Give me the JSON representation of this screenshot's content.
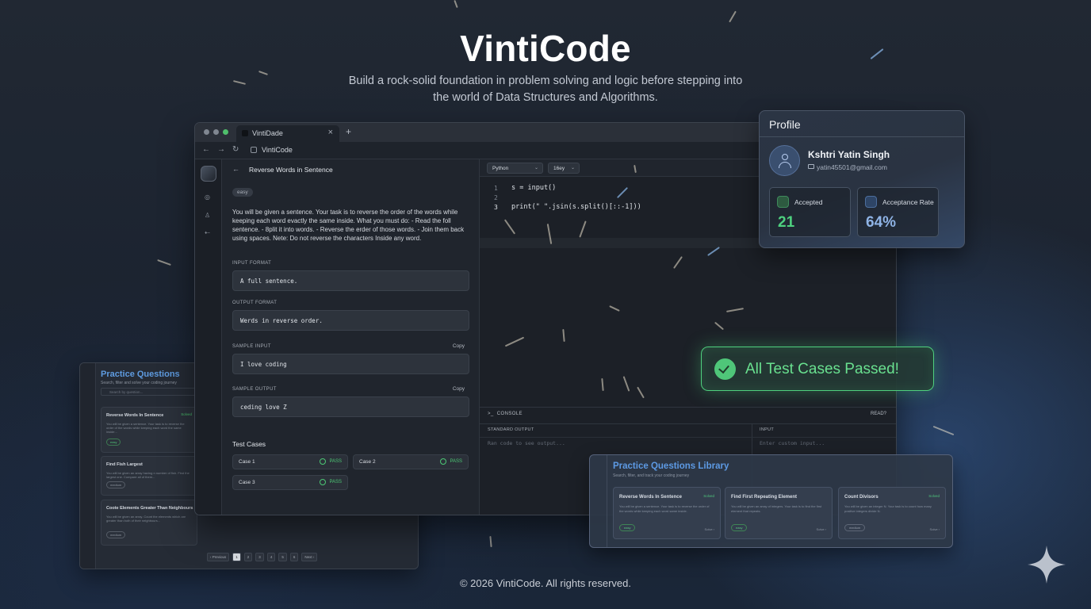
{
  "hero": {
    "title": "VintiCode",
    "subtitle": "Build a rock-solid foundation in problem solving and logic before stepping into the world of Data Structures and Algorithms."
  },
  "footer": "© 2026 VintiCode. All rights reserved.",
  "browser": {
    "tab_title": "VintiDade",
    "tab_close": "×",
    "new_tab": "+",
    "url": "VintiCode",
    "nav_back": "←",
    "nav_forward": "→",
    "nav_reload": "↻"
  },
  "problem": {
    "back": "←",
    "title": "Reverse Words in Sentence",
    "difficulty": "easy",
    "description": "You will be given a sentence. Your task is to reverse the order of the words while keeping each word evactly the same inside. What you must do: - Read the foll sentence. - 8plit it into words. - Reverse the erder of those words. - Join them back using spaces. Nete: Do not reverse the characters Inside any word.",
    "input_format_label": "INPUT FORMAT",
    "input_format": "A full sentence.",
    "output_format_label": "OUTPUT FORMAT",
    "output_format": "Werds in reverse order.",
    "sample_input_label": "SAMPLE INPUT",
    "sample_input": "I love coding",
    "sample_output_label": "SAMPLE OUTPUT",
    "sample_output": "ceding love Z",
    "copy_label": "Copy",
    "test_cases_title": "Test Cases",
    "test_cases": [
      {
        "name": "Case 1",
        "status": "PASS"
      },
      {
        "name": "Case 2",
        "status": "PASS"
      },
      {
        "name": "Case 3",
        "status": "PASS"
      }
    ]
  },
  "editor": {
    "language": "Python",
    "font_size": "16ey",
    "lines": [
      {
        "n": "1",
        "code": "s = input()"
      },
      {
        "n": "2",
        "code": ""
      },
      {
        "n": "3",
        "code": "print(\" \".jsin(s.split()[::-1]))"
      }
    ]
  },
  "console": {
    "title": "CONSOLE",
    "status": "READ?",
    "output_label": "STANDARD OUTPUT",
    "output_placeholder": "Ran code to see output...",
    "input_label": "INPUT",
    "input_placeholder": "Enter custom input..."
  },
  "profile": {
    "title": "Profile",
    "name": "Kshtri Yatin Singh",
    "email": "yatin45501@gmail.com",
    "accepted_label": "Accepted",
    "accepted_value": "21",
    "rate_label": "Acceptance Rate",
    "rate_value": "64%",
    "colors": {
      "accepted": "#4ed07f",
      "rate": "#8fb4e6"
    }
  },
  "toast": {
    "message": "All Test Cases Passed!",
    "color": "#69e08f"
  },
  "practice": {
    "title": "Practice Questions",
    "subtitle": "Search, filter and solve your coding journey",
    "search_placeholder": "Search by question...",
    "cards": [
      {
        "title": "Reverse Words In Sentence",
        "badge": "Solved",
        "desc": "You will be given a sentence. Your task is to reverse the order of the words while keeping each word the same inside...",
        "tag": "easy"
      },
      {
        "title": "Find Fish Largest",
        "badge": "",
        "desc": "You will be given an array having n number of fish. Find the largest one. Compare all of them...",
        "tag": "medium"
      },
      {
        "title": "Coote Elements Greater Than Neighbours",
        "badge": "",
        "desc": "You will be given an array. Count the elements which are greater than both of their neighbours...",
        "tag": "medium"
      }
    ],
    "pager": [
      "‹ Previous",
      "1",
      "2",
      "3",
      "4",
      "5",
      "6",
      "Next ›"
    ]
  },
  "library": {
    "title": "Practice Questions Library",
    "subtitle": "Search, filter, and track your coding journey",
    "cards": [
      {
        "title": "Reverse Words In Sentence",
        "badge": "Solved",
        "desc": "You will be given a sentence. Your task is to reverse the order of the words while keeping each word same inside.",
        "tag": "easy",
        "side": "Solve ›"
      },
      {
        "title": "Find First Repeating Element",
        "badge": "",
        "desc": "You will be given an array of integers. Your task is to find the first element that repeats.",
        "tag": "easy",
        "side": "Solve ›"
      },
      {
        "title": "Count Divisors",
        "badge": "Solved",
        "desc": "You will be given an integer N. Your task is to count how many positive integers divide N.",
        "tag": "medium",
        "side": "Solve ›"
      }
    ]
  }
}
